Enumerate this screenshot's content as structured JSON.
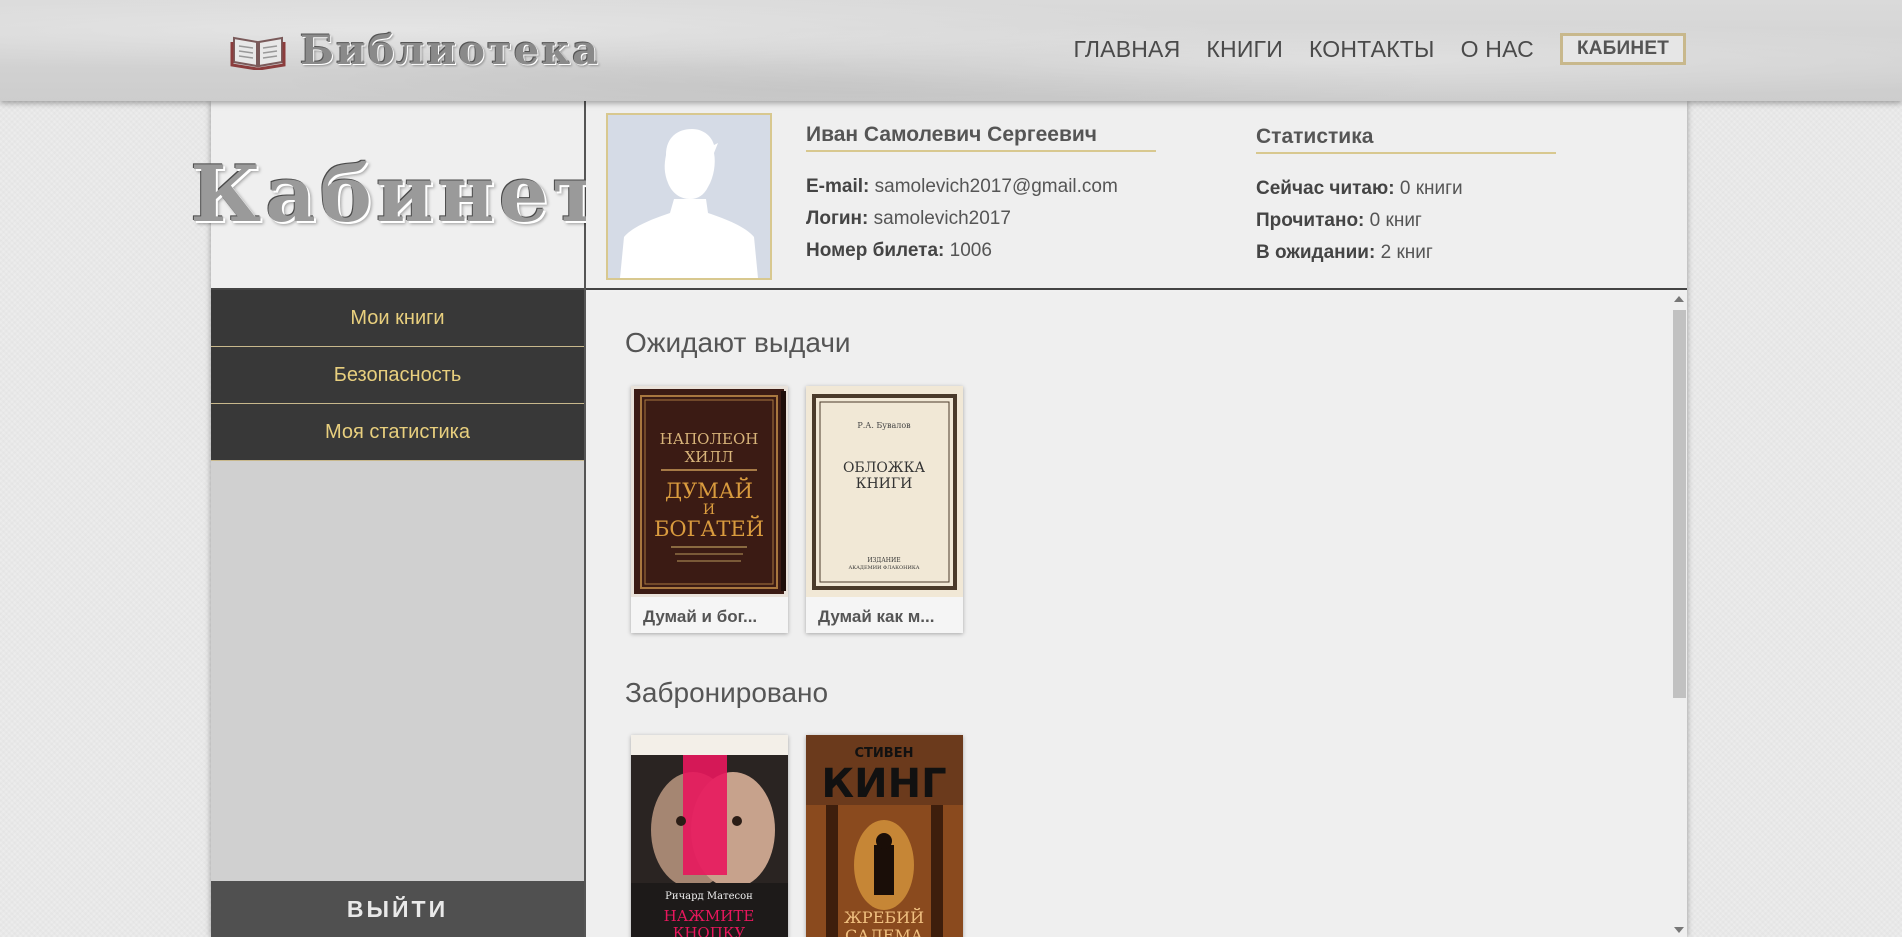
{
  "header": {
    "logo_text": "Библиотека",
    "nav": [
      {
        "label": "ГЛАВНАЯ"
      },
      {
        "label": "КНИГИ"
      },
      {
        "label": "КОНТАКТЫ"
      },
      {
        "label": "О НАС"
      },
      {
        "label": "КАБИНЕТ"
      }
    ]
  },
  "sidebar": {
    "title": "Кабинет",
    "menu": [
      {
        "label": "Мои книги"
      },
      {
        "label": "Безопасность"
      },
      {
        "label": "Моя статистика"
      }
    ],
    "logout_label": "ВЫЙТИ"
  },
  "profile": {
    "name": "Иван Самолевич Сергеевич",
    "email_label": "E-mail:",
    "email": "samolevich2017@gmail.com",
    "login_label": "Логин:",
    "login": "samolevich2017",
    "ticket_label": "Номер билета:",
    "ticket": "1006"
  },
  "stats": {
    "title": "Статистика",
    "reading_label": "Сейчас читаю:",
    "reading": "0 книги",
    "read_label": "Прочитано:",
    "read": "0 книг",
    "waiting_label": "В ожидании:",
    "waiting": "2 книг"
  },
  "sections": {
    "pending_title": "Ожидают выдачи",
    "pending_books": [
      {
        "caption": "Думай и бог...",
        "cover_lines": [
          "НАПОЛЕОН",
          "ХИЛЛ",
          "ДУМАЙ",
          "И",
          "БОГАТЕЙ"
        ]
      },
      {
        "caption": "Думай как м...",
        "cover_lines": [
          "Р.А. Бувалов",
          "ОБЛОЖКА",
          "КНИГИ",
          "ИЗДАНИЕ",
          "АКАДЕМИИ ФЛАКОНИКА"
        ]
      }
    ],
    "reserved_title": "Забронировано",
    "reserved_books": [
      {
        "cover_lines": [
          "Ричард Матесон",
          "НАЖМИТЕ",
          "КНОПКУ"
        ]
      },
      {
        "cover_lines": [
          "СТИВЕН",
          "КИНГ",
          "ЖРЕБИЙ",
          "САЛЕМА"
        ]
      }
    ]
  },
  "colors": {
    "menu_bg": "#383838",
    "menu_text": "#e8cf7e",
    "accent_gold": "#d8c88f"
  }
}
